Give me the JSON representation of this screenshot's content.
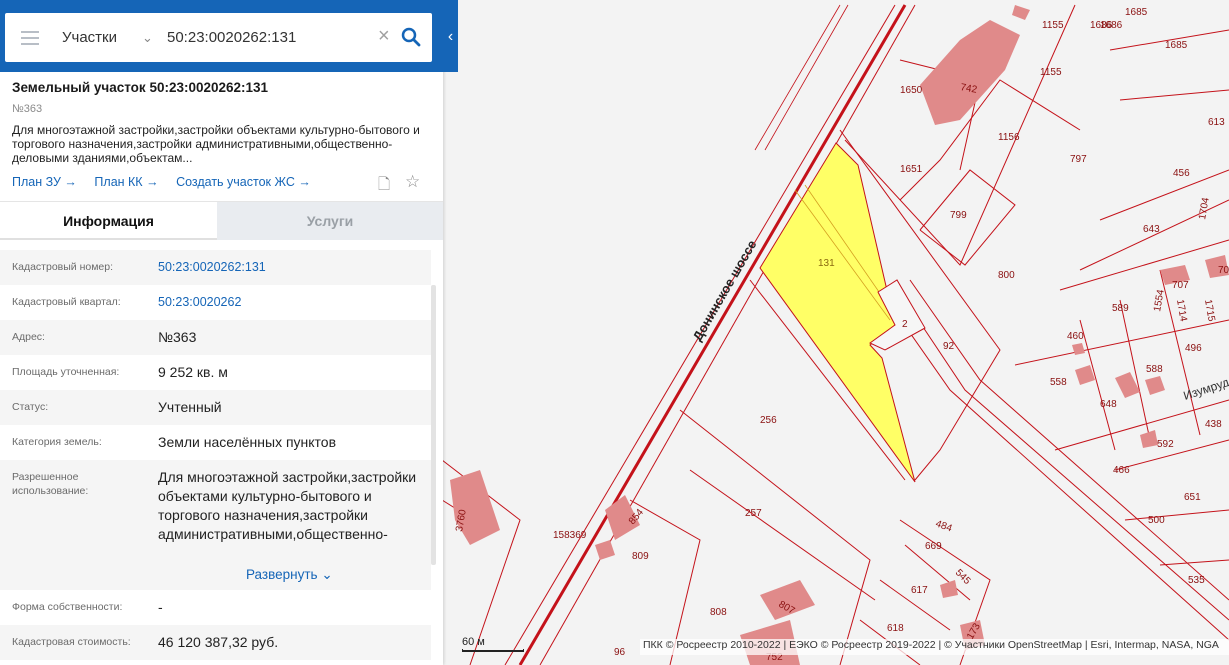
{
  "search": {
    "layer": "Участки",
    "query": "50:23:0020262:131"
  },
  "parcel": {
    "title": "Земельный участок 50:23:0020262:131",
    "subtitle": "№363",
    "description": "Для многоэтажной застройки,застройки объектами культурно-бытового и торгового назначения,застройки административными,общественно-деловыми зданиями,объектам...",
    "links": [
      "План ЗУ →",
      "План КК →",
      "Создать участок ЖС →"
    ]
  },
  "tabs": {
    "info": "Информация",
    "services": "Услуги"
  },
  "fields": [
    {
      "label": "Кадастровый номер:",
      "value": "50:23:0020262:131"
    },
    {
      "label": "Кадастровый квартал:",
      "value": "50:23:0020262"
    },
    {
      "label": "Адрес:",
      "value": "№363"
    },
    {
      "label": "Площадь уточненная:",
      "value": "9 252 кв. м"
    },
    {
      "label": "Статус:",
      "value": "Учтенный"
    },
    {
      "label": "Категория земель:",
      "value": "Земли населённых пунктов"
    },
    {
      "label": "Разрешенное использование:",
      "value": "Для многоэтажной застройки,застройки объектами культурно-бытового и торгового назначения,застройки административными,общественно-"
    },
    {
      "label": "Форма собственности:",
      "value": "-"
    },
    {
      "label": "Кадастровая стоимость:",
      "value": "46 120 387,32 руб."
    }
  ],
  "expand_label": "Развернуть",
  "map": {
    "road_label": "Донинское шоссе",
    "street_label": "Изумруд",
    "selected_parcel_label": "131",
    "parcel_labels": [
      "1685",
      "1686",
      "1685",
      "1155",
      "1155",
      "1686",
      "742",
      "1650",
      "1651",
      "1156",
      "797",
      "456",
      "613",
      "799",
      "643",
      "1704",
      "800",
      "589",
      "707",
      "1554",
      "1714",
      "1715",
      "70",
      "2",
      "92",
      "460",
      "558",
      "588",
      "496",
      "648",
      "592",
      "438",
      "466",
      "651",
      "500",
      "535",
      "256",
      "257",
      "158369",
      "854",
      "3760",
      "809",
      "484",
      "669",
      "545",
      "617",
      "808",
      "807",
      "618",
      "752",
      "96",
      "173"
    ],
    "scale_label": "60 м",
    "attribution": "ПКК © Росреестр 2010-2022 | ЕЭКО © Росреестр 2019-2022 | © Участники OpenStreetMap | Esri, Intermap, NASA, NGA"
  },
  "colors": {
    "header": "#1565b7",
    "selected_fill": "#ffff66",
    "parcel_line": "#b8141c",
    "building": "#e08a8a"
  }
}
